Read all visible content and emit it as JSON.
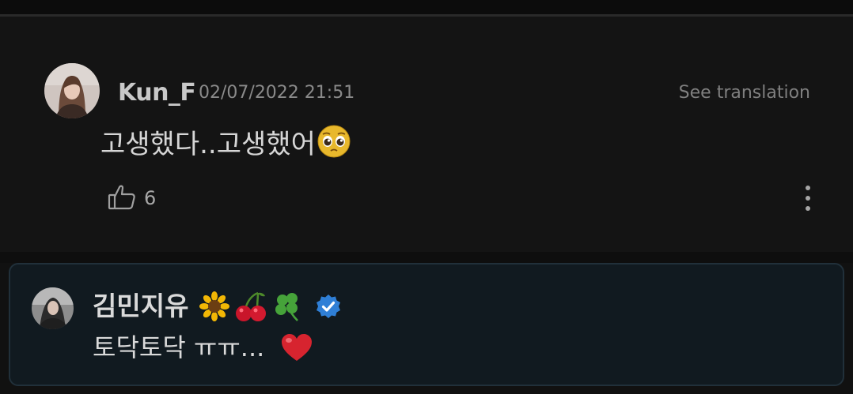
{
  "comment": {
    "author": "Kun_F",
    "timestamp": "02/07/2022 21:51",
    "see_translation_label": "See translation",
    "text": "고생했다..고생했어",
    "emoji_icon": "pleading-face-icon",
    "like_count": "6",
    "like_icon": "thumbs-up-icon",
    "more_icon": "more-vertical-icon"
  },
  "reply": {
    "author": "김민지유",
    "author_emojis": [
      "sunflower-icon",
      "cherries-icon",
      "four-leaf-clover-icon"
    ],
    "verified_icon": "verified-badge-icon",
    "verified_color": "#2f7fd6",
    "text": "토닥토닥 ㅠㅠ...",
    "heart_icon": "red-heart-icon"
  },
  "colors": {
    "background": "#111111",
    "reply_border": "#21303a",
    "reply_background": "#111a20"
  }
}
